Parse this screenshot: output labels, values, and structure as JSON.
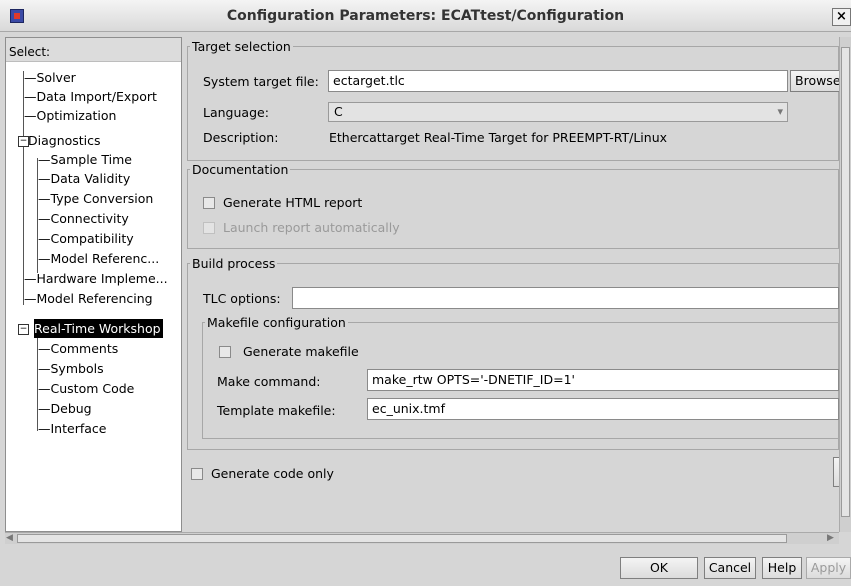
{
  "window": {
    "title": "Configuration Parameters: ECATtest/Configuration",
    "close": "×"
  },
  "tree": {
    "header": "Select:",
    "items": [
      {
        "label": "Solver"
      },
      {
        "label": "Data Import/Export"
      },
      {
        "label": "Optimization"
      },
      {
        "label": "Diagnostics",
        "expander": "−"
      },
      {
        "label": "Sample Time"
      },
      {
        "label": "Data Validity"
      },
      {
        "label": "Type Conversion"
      },
      {
        "label": "Connectivity"
      },
      {
        "label": "Compatibility"
      },
      {
        "label": "Model Referenc..."
      },
      {
        "label": "Hardware Impleme..."
      },
      {
        "label": "Model Referencing"
      },
      {
        "label": "Real-Time Workshop",
        "expander": "−"
      },
      {
        "label": "Comments"
      },
      {
        "label": "Symbols"
      },
      {
        "label": "Custom Code"
      },
      {
        "label": "Debug"
      },
      {
        "label": "Interface"
      }
    ]
  },
  "target_selection": {
    "legend": "Target selection",
    "system_target_label": "System target file:",
    "system_target_value": "ectarget.tlc",
    "browse_label": "Browse",
    "language_label": "Language:",
    "language_value": "C",
    "description_label": "Description:",
    "description_value": "Ethercattarget Real-Time Target for PREEMPT-RT/Linux"
  },
  "documentation": {
    "legend": "Documentation",
    "generate_html": "Generate HTML report",
    "launch_report": "Launch report automatically"
  },
  "build_process": {
    "legend": "Build process",
    "tlc_options_label": "TLC options:",
    "tlc_options_value": "",
    "makefile": {
      "legend": "Makefile configuration",
      "generate_makefile": "Generate makefile",
      "make_command_label": "Make command:",
      "make_command_value": "make_rtw OPTS='-DNETIF_ID=1'",
      "template_makefile_label": "Template makefile:",
      "template_makefile_value": "ec_unix.tmf"
    }
  },
  "generate_code_only": "Generate code only",
  "buttons": {
    "ok": "OK",
    "cancel": "Cancel",
    "help": "Help",
    "apply": "Apply"
  }
}
